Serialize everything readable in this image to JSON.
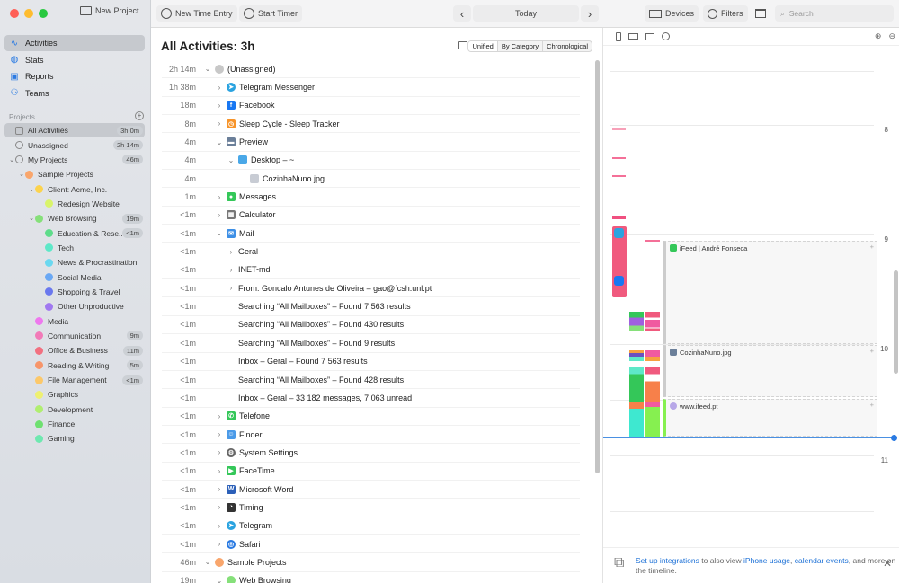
{
  "window": {
    "traffic_colors": [
      "#ff5f57",
      "#febc2e",
      "#28c840"
    ]
  },
  "sidebar": {
    "new_project": "New Project",
    "nav": [
      {
        "label": "Activities",
        "icon": "activity-icon",
        "selected": true
      },
      {
        "label": "Stats",
        "icon": "stats-icon"
      },
      {
        "label": "Reports",
        "icon": "reports-icon"
      },
      {
        "label": "Teams",
        "icon": "teams-icon"
      }
    ],
    "projects_header": "Projects",
    "projects": [
      {
        "label": "All Activities",
        "badge": "3h 0m",
        "level": 0,
        "kind": "all",
        "selected": true
      },
      {
        "label": "Unassigned",
        "badge": "2h 14m",
        "level": 0,
        "kind": "unassigned"
      },
      {
        "label": "My Projects",
        "badge": "46m",
        "level": 0,
        "kind": "user",
        "chevron": "down"
      },
      {
        "label": "Sample Projects",
        "level": 1,
        "color": "#f9a66c",
        "chevron": "down"
      },
      {
        "label": "Client: Acme, Inc.",
        "level": 2,
        "color": "#fcd34d",
        "chevron": "down"
      },
      {
        "label": "Redesign Website",
        "level": 3,
        "color": "#d9f46a"
      },
      {
        "label": "Web Browsing",
        "badge": "19m",
        "level": 2,
        "color": "#86e07a",
        "chevron": "down"
      },
      {
        "label": "Education & Rese...",
        "badge": "<1m",
        "level": 3,
        "color": "#5edc8a"
      },
      {
        "label": "Tech",
        "level": 3,
        "color": "#5ee8c8"
      },
      {
        "label": "News & Procrastination",
        "level": 3,
        "color": "#6ad8f0"
      },
      {
        "label": "Social Media",
        "level": 3,
        "color": "#6aa8f4"
      },
      {
        "label": "Shopping & Travel",
        "level": 3,
        "color": "#6a78ee"
      },
      {
        "label": "Other Unproductive",
        "level": 3,
        "color": "#a078f0"
      },
      {
        "label": "Media",
        "level": 2,
        "color": "#ee78ee"
      },
      {
        "label": "Communication",
        "badge": "9m",
        "level": 2,
        "color": "#f27ab8"
      },
      {
        "label": "Office & Business",
        "badge": "11m",
        "level": 2,
        "color": "#f27080"
      },
      {
        "label": "Reading & Writing",
        "badge": "5m",
        "level": 2,
        "color": "#f7956a"
      },
      {
        "label": "File Management",
        "badge": "<1m",
        "level": 2,
        "color": "#fcc86a"
      },
      {
        "label": "Graphics",
        "level": 2,
        "color": "#eef070"
      },
      {
        "label": "Development",
        "level": 2,
        "color": "#b0ee70"
      },
      {
        "label": "Finance",
        "level": 2,
        "color": "#6ee070"
      },
      {
        "label": "Gaming",
        "level": 2,
        "color": "#6ee8b0"
      }
    ]
  },
  "toolbar": {
    "new_time_entry": "New Time Entry",
    "start_timer": "Start Timer",
    "date": "Today",
    "devices": "Devices",
    "filters": "Filters",
    "search_placeholder": "Search"
  },
  "main": {
    "title": "All Activities: 3h",
    "view_modes": [
      "Unified",
      "By Category",
      "Chronological"
    ],
    "selected_view": "Unified",
    "rows": [
      {
        "time": "2h 14m",
        "level": 0,
        "chevron": "down",
        "icon": "#c8c8c8",
        "round": true,
        "label": "(Unassigned)"
      },
      {
        "time": "1h 38m",
        "level": 1,
        "chevron": "right",
        "icon": "#2aa3e0",
        "round": true,
        "glyph": "➤",
        "label": "Telegram Messenger"
      },
      {
        "time": "18m",
        "level": 1,
        "chevron": "right",
        "icon": "#1877f2",
        "glyph": "f",
        "label": "Facebook"
      },
      {
        "time": "8m",
        "level": 1,
        "chevron": "right",
        "icon": "#f7942a",
        "glyph": "◷",
        "label": "Sleep Cycle - Sleep Tracker"
      },
      {
        "time": "4m",
        "level": 1,
        "chevron": "down",
        "icon": "#6b7f99",
        "glyph": "▬",
        "label": "Preview"
      },
      {
        "time": "4m",
        "level": 2,
        "chevron": "down",
        "icon": "#4aa8e8",
        "label": "Desktop – ~"
      },
      {
        "time": "4m",
        "level": 3,
        "chevron": "none",
        "icon": "#c8ccd4",
        "label": "CozinhaNuno.jpg"
      },
      {
        "time": "1m",
        "level": 1,
        "chevron": "right",
        "icon": "#34c759",
        "glyph": "●",
        "label": "Messages"
      },
      {
        "time": "<1m",
        "level": 1,
        "chevron": "right",
        "icon": "#777",
        "glyph": "▦",
        "label": "Calculator"
      },
      {
        "time": "<1m",
        "level": 1,
        "chevron": "down",
        "icon": "#3d8fe6",
        "glyph": "✉",
        "label": "Mail"
      },
      {
        "time": "<1m",
        "level": 2,
        "chevron": "right",
        "icon": "none",
        "label": "Geral"
      },
      {
        "time": "<1m",
        "level": 2,
        "chevron": "right",
        "icon": "none",
        "label": "INET-md"
      },
      {
        "time": "<1m",
        "level": 2,
        "chevron": "right",
        "icon": "none",
        "label": "From: Goncalo Antunes de Oliveira – gao@fcsh.unl.pt"
      },
      {
        "time": "<1m",
        "level": 2,
        "chevron": "none",
        "icon": "none",
        "label": "Searching “All Mailboxes” – Found 7 563 results"
      },
      {
        "time": "<1m",
        "level": 2,
        "chevron": "none",
        "icon": "none",
        "label": "Searching “All Mailboxes” – Found 430 results"
      },
      {
        "time": "<1m",
        "level": 2,
        "chevron": "none",
        "icon": "none",
        "label": "Searching “All Mailboxes” – Found 9 results"
      },
      {
        "time": "<1m",
        "level": 2,
        "chevron": "none",
        "icon": "none",
        "label": "Inbox – Geral – Found 7 563 results"
      },
      {
        "time": "<1m",
        "level": 2,
        "chevron": "none",
        "icon": "none",
        "label": "Searching “All Mailboxes” – Found 428 results"
      },
      {
        "time": "<1m",
        "level": 2,
        "chevron": "none",
        "icon": "none",
        "label": "Inbox – Geral – 33 182 messages, 7 063 unread"
      },
      {
        "time": "<1m",
        "level": 1,
        "chevron": "right",
        "icon": "#34c759",
        "glyph": "✆",
        "label": "Telefone"
      },
      {
        "time": "<1m",
        "level": 1,
        "chevron": "right",
        "icon": "#4a9ae8",
        "glyph": "☺",
        "label": "Finder"
      },
      {
        "time": "<1m",
        "level": 1,
        "chevron": "right",
        "icon": "#666",
        "round": true,
        "glyph": "⚙",
        "label": "System Settings"
      },
      {
        "time": "<1m",
        "level": 1,
        "chevron": "right",
        "icon": "#34c759",
        "glyph": "▶",
        "label": "FaceTime"
      },
      {
        "time": "<1m",
        "level": 1,
        "chevron": "right",
        "icon": "#2b5fb8",
        "glyph": "W",
        "label": "Microsoft Word"
      },
      {
        "time": "<1m",
        "level": 1,
        "chevron": "right",
        "icon": "#333",
        "glyph": "◔",
        "label": "Timing"
      },
      {
        "time": "<1m",
        "level": 1,
        "chevron": "right",
        "icon": "#2aa3e0",
        "round": true,
        "glyph": "➤",
        "label": "Telegram"
      },
      {
        "time": "<1m",
        "level": 1,
        "chevron": "right",
        "icon": "#2a7ae2",
        "round": true,
        "glyph": "◎",
        "label": "Safari"
      },
      {
        "time": "46m",
        "level": 0,
        "chevron": "down",
        "icon": "#f9a66c",
        "round": true,
        "label": "Sample Projects"
      },
      {
        "time": "19m",
        "level": 1,
        "chevron": "down",
        "icon": "#86e07a",
        "round": true,
        "label": "Web Browsing"
      }
    ]
  },
  "timeline": {
    "hours": [
      "8",
      "9",
      "10",
      "11"
    ],
    "events": [
      {
        "label": "iFeed | André Fonseca",
        "icon": "messages-icon"
      },
      {
        "label": "CozinhaNuno.jpg",
        "icon": "preview-icon"
      },
      {
        "label": "www.ifeed.pt",
        "icon": "web-icon"
      }
    ],
    "banner": {
      "link": "Set up integrations",
      "text1": " to also view ",
      "link2": "iPhone usage",
      "sep": ", ",
      "link3": "calendar events",
      "text2": ", and more on the timeline."
    }
  }
}
